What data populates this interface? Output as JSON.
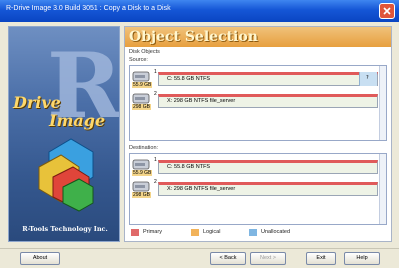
{
  "window": {
    "title": "R-Drive Image 3.0 Build 3051 : Copy a Disk to a Disk"
  },
  "sidebar": {
    "brand_line1": "Drive",
    "brand_line2": "Image",
    "company": "R-Tools Technology Inc."
  },
  "main": {
    "heading": "Object Selection",
    "disk_objects_label": "Disk Objects",
    "source_label": "Source:",
    "destination_label": "Destination:",
    "source_disks": [
      {
        "num": "1",
        "size": "55.9 GB",
        "partition": "C: 55.8 GB  NTFS",
        "free": "?"
      },
      {
        "num": "2",
        "size": "298 GB",
        "partition": "X: 298 GB  NTFS  file_server"
      }
    ],
    "destination_disks": [
      {
        "num": "1",
        "size": "55.9 GB",
        "partition": "C: 55.8 GB  NTFS"
      },
      {
        "num": "2",
        "size": "298 GB",
        "partition": "X: 298 GB  NTFS  file_server"
      }
    ],
    "legend": [
      {
        "label": "Primary",
        "color": "#e06a6a"
      },
      {
        "label": "Logical",
        "color": "#f2b35a"
      },
      {
        "label": "Unallocated",
        "color": "#7fb6e2"
      }
    ]
  },
  "buttons": {
    "about": "About",
    "back": "< Back",
    "next": "Next >",
    "exit": "Exit",
    "help": "Help"
  }
}
